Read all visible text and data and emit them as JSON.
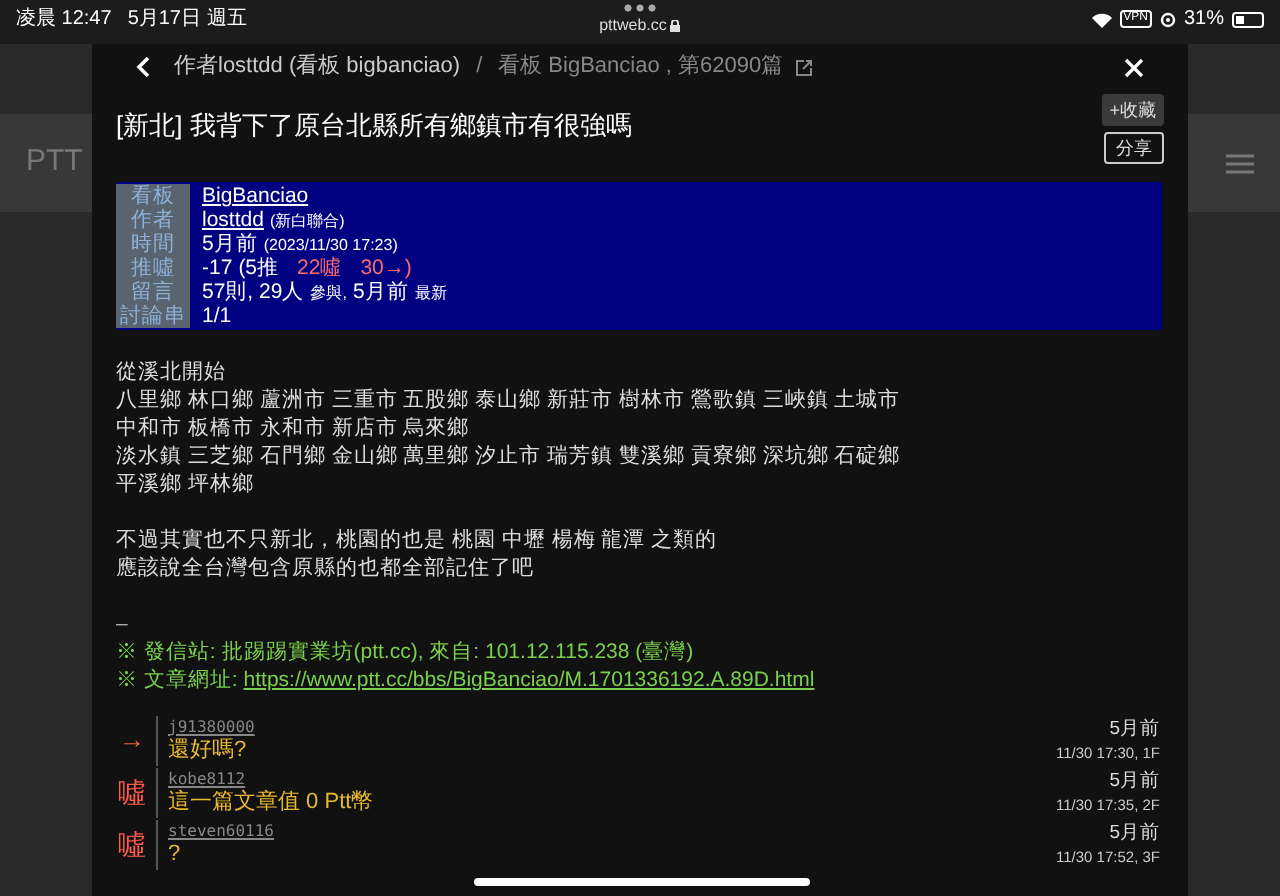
{
  "status_bar": {
    "time": "凌晨 12:47",
    "date": "5月17日 週五",
    "url": "pttweb.cc",
    "vpn": "VPN",
    "battery": "31%"
  },
  "background": {
    "site_title": "PTT"
  },
  "modal": {
    "breadcrumb": {
      "author": "作者losttdd (看板 bigbanciao)",
      "separator": "/",
      "board": "看板 BigBanciao , 第62090篇"
    },
    "title": "[新北] 我背下了原台北縣所有鄉鎮市有很強嗎",
    "buttons": [
      {
        "label": "+收藏",
        "kind": "filled"
      },
      {
        "label": "分享",
        "kind": "outline"
      }
    ],
    "meta": [
      {
        "label": "看板",
        "parts": [
          {
            "text": "BigBanciao",
            "kind": "link"
          }
        ]
      },
      {
        "label": "作者",
        "parts": [
          {
            "text": "losttdd",
            "kind": "link"
          },
          {
            "text": "(新白聯合)",
            "kind": "small"
          }
        ]
      },
      {
        "label": "時間",
        "parts": [
          {
            "text": "5月前",
            "kind": "text"
          },
          {
            "text": "(2023/11/30 17:23)",
            "kind": "small"
          }
        ]
      },
      {
        "label": "推噓",
        "parts": [
          {
            "text": "-17",
            "kind": "text"
          },
          {
            "text": "(5推",
            "kind": "text"
          },
          {
            "text": "22噓",
            "kind": "red"
          },
          {
            "text": "30→)",
            "kind": "red"
          }
        ]
      },
      {
        "label": "留言",
        "parts": [
          {
            "text": "57則, 29人",
            "kind": "text"
          },
          {
            "text": "參與,",
            "kind": "small"
          },
          {
            "text": "5月前",
            "kind": "text"
          },
          {
            "text": "最新",
            "kind": "small"
          }
        ]
      },
      {
        "label": "討論串",
        "parts": [
          {
            "text": "1/1",
            "kind": "text"
          }
        ]
      }
    ],
    "body": [
      [
        "從溪北開始",
        "八里鄉 林口鄉 蘆洲市 三重市 五股鄉 泰山鄉 新莊市 樹林市 鶯歌鎮 三峽鎮 土城市",
        "中和市 板橋市 永和市 新店市 烏來鄉",
        "淡水鎮 三芝鄉 石門鄉 金山鄉 萬里鄉 汐止市 瑞芳鎮 雙溪鄉 貢寮鄉 深坑鄉 石碇鄉",
        "平溪鄉 坪林鄉"
      ],
      [
        "不過其實也不只新北，桃園的也是 桃園 中壢 楊梅 龍潭 之類的",
        "應該說全台灣包含原縣的也都全部記住了吧"
      ]
    ],
    "signature": {
      "dashes": "–",
      "origin": "※ 發信站: 批踢踢實業坊(ptt.cc), 來自: 101.12.115.238 (臺灣)",
      "url_label": "※ 文章網址: ",
      "url": "https://www.ptt.cc/bbs/BigBanciao/M.1701336192.A.89D.html"
    },
    "comments": [
      {
        "tag": "→",
        "kind": "arrow",
        "user": "j91380000",
        "text": "還好嗎?",
        "ago": "5月前",
        "datetime": "11/30 17:30, 1F"
      },
      {
        "tag": "噓",
        "kind": "boo",
        "user": "kobe8112",
        "text": "這一篇文章值 0 Ptt幣",
        "ago": "5月前",
        "datetime": "11/30 17:35, 2F"
      },
      {
        "tag": "噓",
        "kind": "boo",
        "user": "steven60116",
        "text": "?",
        "ago": "5月前",
        "datetime": "11/30 17:52, 3F"
      }
    ]
  }
}
